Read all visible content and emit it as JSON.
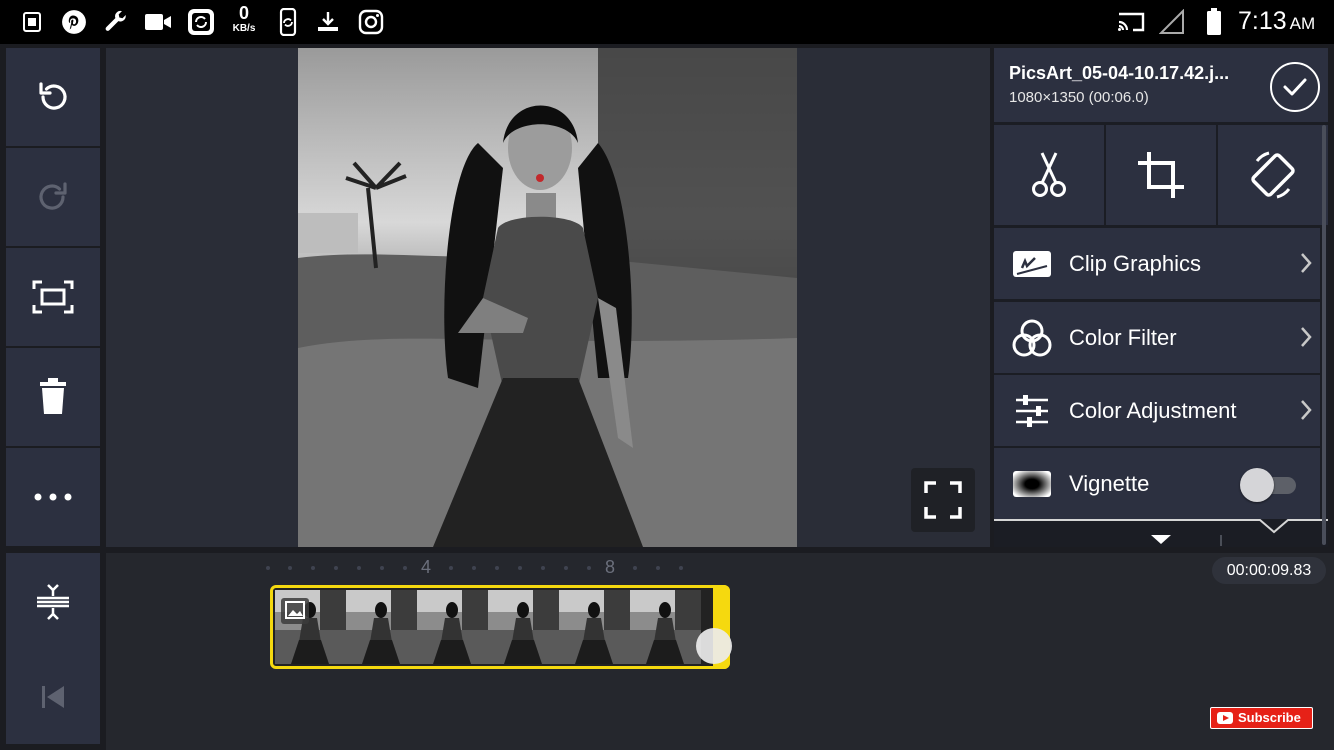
{
  "status_bar": {
    "net_speed_value": "0",
    "net_speed_unit": "KB/s",
    "time": "7:13",
    "ampm": "AM",
    "left_icons": [
      "screenshot-icon",
      "pinterest-icon",
      "wrench-icon",
      "video-camera-icon",
      "screen-recorder-icon",
      "phone-sync-icon",
      "download-icon",
      "instagram-icon"
    ],
    "right_icons": [
      "cast-icon",
      "signal-icon",
      "battery-icon"
    ]
  },
  "left_toolbar": [
    "undo-icon",
    "redo-icon",
    "fit-screen-icon",
    "delete-icon",
    "more-icon"
  ],
  "timeline_toolbar": [
    "expand-timeline-icon",
    "skip-to-start-icon"
  ],
  "clip": {
    "name": "PicsArt_05-04-10.17.42.j...",
    "info": "1080×1350 (00:06.0)"
  },
  "tools": [
    "scissors-icon",
    "crop-icon",
    "rotate-icon"
  ],
  "menu": {
    "clip_graphics": "Clip Graphics",
    "color_filter": "Color Filter",
    "color_adjustment": "Color Adjustment",
    "vignette": "Vignette",
    "vignette_on": false
  },
  "timeline": {
    "ruler_labels": [
      "4",
      "8"
    ],
    "current_time": "00:00:09.83",
    "frame_count": 6
  },
  "overlay": {
    "subscribe": "Subscribe"
  },
  "colors": {
    "accent_yellow": "#f5d90f",
    "panel": "#2c3040",
    "subscribe_red": "#e62117"
  }
}
